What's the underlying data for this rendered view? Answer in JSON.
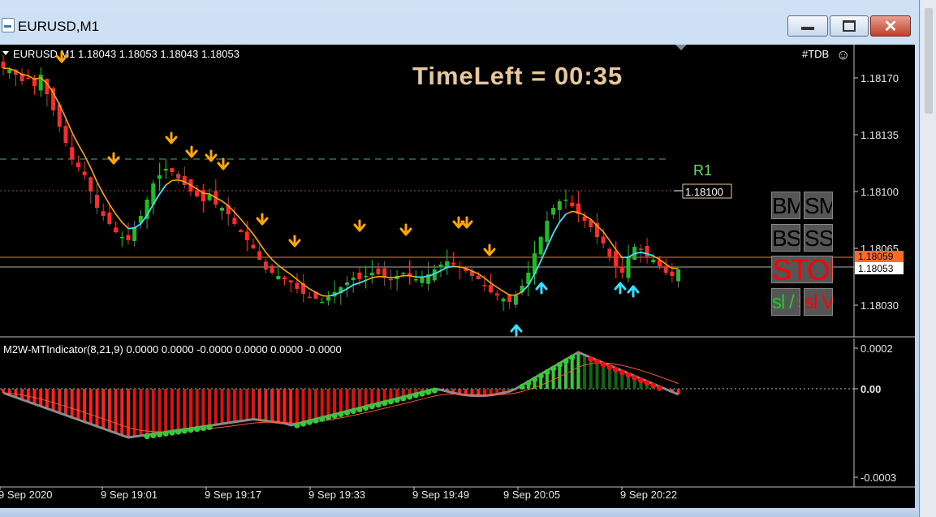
{
  "window": {
    "title": "EURUSD,M1",
    "minimize_symbol": "—",
    "maximize_symbol": "□",
    "close_symbol": "✕"
  },
  "header": {
    "symbol_line": "EURUSD,M1  1.18043 1.18053 1.18043 1.18053",
    "tdb_label": "#TDB",
    "smiley": "☺"
  },
  "timeleft": "TimeLeft = 00:35",
  "levels": {
    "r1_label": "R1",
    "r1_value": "1.18100",
    "current_price": "1.18053",
    "orange_price": "1.18059"
  },
  "price_axis": [
    "1.18170",
    "1.18135",
    "1.18100",
    "1.18065",
    "1.18030"
  ],
  "indicator": {
    "label": "M2W-MTIndicator(8,21,9) 0.0000 0.0000 -0.0000 0.0000 0.0000 -0.0000",
    "axis": [
      "0.0002",
      "0.00",
      "-0.0003"
    ]
  },
  "time_axis": [
    "9 Sep 2020",
    "9 Sep 19:01",
    "9 Sep 19:17",
    "9 Sep 19:33",
    "9 Sep 19:49",
    "9 Sep 20:05",
    "9 Sep 20:22"
  ],
  "trade_panel": {
    "bm": "BM",
    "sm": "SM",
    "bs": "BS",
    "ss": "SS",
    "stop": "STOP",
    "sl_left": "sl / sl",
    "sl_right": "sl V"
  },
  "colors": {
    "bull": "#22bb22",
    "bear": "#ff2a2a",
    "ma_orange": "#ffa500",
    "ma_cyan": "#33e0ff",
    "arrow_down": "#ffa500",
    "arrow_up": "#33e0ff",
    "r1_green": "#66dd66",
    "price_line_orange": "#ff7a2a"
  },
  "chart_data": {
    "type": "candlestick",
    "symbol": "EURUSD",
    "timeframe": "M1",
    "ohlc_last": {
      "open": 1.18043,
      "high": 1.18053,
      "low": 1.18043,
      "close": 1.18053
    },
    "ylim": [
      1.1802,
      1.1819
    ],
    "r1": 1.181,
    "close": [
      1.18176,
      1.18175,
      1.18172,
      1.18168,
      1.1817,
      1.18165,
      1.18172,
      1.1816,
      1.1815,
      1.1814,
      1.1813,
      1.1812,
      1.18115,
      1.1811,
      1.181,
      1.1809,
      1.18085,
      1.1808,
      1.18075,
      1.18072,
      1.1807,
      1.18078,
      1.18085,
      1.18095,
      1.18105,
      1.1811,
      1.18114,
      1.18112,
      1.18108,
      1.18104,
      1.181,
      1.18097,
      1.18094,
      1.18098,
      1.18092,
      1.1809,
      1.18086,
      1.1808,
      1.18075,
      1.1807,
      1.18065,
      1.18058,
      1.18052,
      1.1805,
      1.18048,
      1.18046,
      1.18044,
      1.1804,
      1.18037,
      1.18035,
      1.18034,
      1.18032,
      1.18035,
      1.18038,
      1.18041,
      1.18044,
      1.18047,
      1.18046,
      1.18048,
      1.1805,
      1.18049,
      1.18047,
      1.18046,
      1.18048,
      1.1805,
      1.18048,
      1.18046,
      1.18047,
      1.18049,
      1.18052,
      1.18055,
      1.18057,
      1.18055,
      1.18053,
      1.18051,
      1.18048,
      1.18046,
      1.18042,
      1.18038,
      1.18036,
      1.18034,
      1.18032,
      1.18036,
      1.18042,
      1.1805,
      1.18062,
      1.18072,
      1.18082,
      1.1809,
      1.18094,
      1.18095,
      1.18091,
      1.18086,
      1.18082,
      1.18078,
      1.18072,
      1.18068,
      1.1806,
      1.18054,
      1.1805,
      1.1806,
      1.18066,
      1.18064,
      1.1806,
      1.18058,
      1.18054,
      1.1805,
      1.18048,
      1.18052
    ],
    "oscillator_range": [
      -0.0003,
      0.0002
    ]
  }
}
